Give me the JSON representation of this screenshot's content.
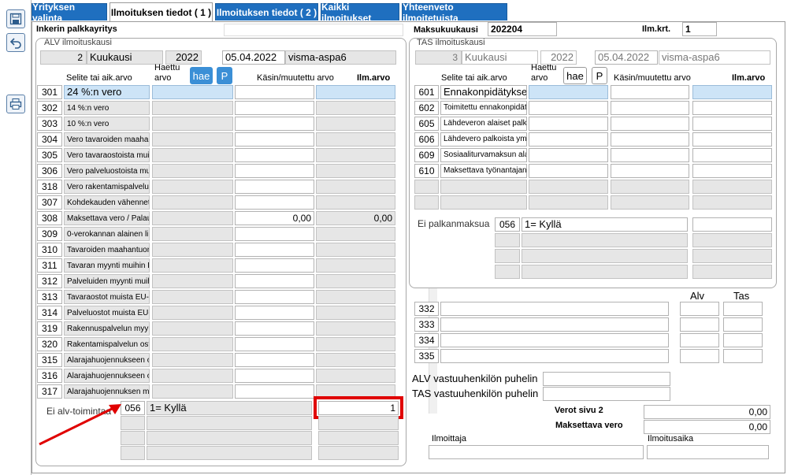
{
  "tabs": [
    {
      "label": "Yrityksen valinta"
    },
    {
      "label": "Ilmoituksen tiedot ( 1 )"
    },
    {
      "label": "Ilmoituksen tiedot ( 2 )"
    },
    {
      "label": "Kaikki ilmoitukset"
    },
    {
      "label": "Yhteenveto ilmoitetuista"
    }
  ],
  "company": "Inkerin palkkayritys",
  "maksukuukausi": {
    "label": "Maksukuukausi",
    "value": "202204"
  },
  "ilmkrt": {
    "label": "Ilm.krt.",
    "value": "1"
  },
  "alv": {
    "legend": "ALV ilmoituskausi",
    "period_num": "2",
    "period_type": "Kuukausi",
    "year": "2022",
    "date": "05.04.2022",
    "system": "visma-aspa6",
    "col_selite": "Selite tai aik.arvo",
    "col_haettu": "Haettu\narvo",
    "hae": "hae",
    "p": "P",
    "col_kasin": "Käsin/muutettu arvo",
    "col_ilm": "Ilm.arvo",
    "rows": [
      {
        "code": "301",
        "desc": "24 %:n vero",
        "kasin": "",
        "ilm": ""
      },
      {
        "code": "302",
        "desc": "14 %:n vero",
        "kasin": "",
        "ilm": ""
      },
      {
        "code": "303",
        "desc": "10 %:n vero",
        "kasin": "",
        "ilm": ""
      },
      {
        "code": "304",
        "desc": "Vero tavaroiden maahan",
        "kasin": "",
        "ilm": ""
      },
      {
        "code": "305",
        "desc": "Vero tavaraostoista muis",
        "kasin": "",
        "ilm": ""
      },
      {
        "code": "306",
        "desc": "Vero palveluostoista mui",
        "kasin": "",
        "ilm": ""
      },
      {
        "code": "318",
        "desc": "Vero rakentamispalvelun",
        "kasin": "",
        "ilm": ""
      },
      {
        "code": "307",
        "desc": "Kohdekauden vähennett",
        "kasin": "",
        "ilm": ""
      },
      {
        "code": "308",
        "desc": "Maksettava vero / Palaut",
        "kasin": "0,00",
        "ilm": "0,00"
      },
      {
        "code": "309",
        "desc": "0-verokannan alainen liik",
        "kasin": "",
        "ilm": ""
      },
      {
        "code": "310",
        "desc": "Tavaroiden maahantuonı",
        "kasin": "",
        "ilm": ""
      },
      {
        "code": "311",
        "desc": "Tavaran myynti muihin E",
        "kasin": "",
        "ilm": ""
      },
      {
        "code": "312",
        "desc": "Palveluiden myynti muih",
        "kasin": "",
        "ilm": ""
      },
      {
        "code": "313",
        "desc": "Tavaraostot muista EU-n",
        "kasin": "",
        "ilm": ""
      },
      {
        "code": "314",
        "desc": "Palveluostot muista EU-r",
        "kasin": "",
        "ilm": ""
      },
      {
        "code": "319",
        "desc": "Rakennuspalvelun myyn",
        "kasin": "",
        "ilm": ""
      },
      {
        "code": "320",
        "desc": "Rakentamispalvelun osto",
        "kasin": "",
        "ilm": ""
      },
      {
        "code": "315",
        "desc": "Alarajahuojennukseen oi",
        "kasin": "",
        "ilm": ""
      },
      {
        "code": "316",
        "desc": "Alarajahuojennukseen oi",
        "kasin": "",
        "ilm": ""
      },
      {
        "code": "317",
        "desc": "Alarajahuojennuksen mä",
        "kasin": "",
        "ilm": ""
      }
    ],
    "ei_alv_label": "Ei alv-toimintaa",
    "ei_alv_code": "056",
    "ei_alv_value": "1= Kyllä",
    "ei_alv_ilm": "1"
  },
  "tas": {
    "legend": "TAS ilmoituskausi",
    "period_num": "3",
    "period_type": "Kuukausi",
    "year": "2022",
    "date": "05.04.2022",
    "system": "visma-aspa6",
    "col_selite": "Selite tai aik.arvo",
    "col_haettu": "Haettu\narvo",
    "hae": "hae",
    "p": "P",
    "col_kasin": "Käsin/muutettu arvo",
    "col_ilm": "Ilm.arvo",
    "rows": [
      {
        "code": "601",
        "desc": "Ennakonpidätykse"
      },
      {
        "code": "602",
        "desc": "Toimitettu ennakonpidät"
      },
      {
        "code": "605",
        "desc": "Lähdeveron alaiset palka"
      },
      {
        "code": "606",
        "desc": "Lähdevero palkoista yms"
      },
      {
        "code": "609",
        "desc": "Sosiaaliturvamaksun alai"
      },
      {
        "code": "610",
        "desc": "Maksettava työnantajan"
      }
    ],
    "ei_palk_label": "Ei palkanmaksua",
    "ei_palk_code": "056",
    "ei_palk_value": "1= Kyllä"
  },
  "extra": {
    "alv_head": "Alv",
    "tas_head": "Tas",
    "codes": [
      "332",
      "333",
      "334",
      "335"
    ]
  },
  "phones": {
    "alv": "ALV vastuuhenkilön puhelin",
    "tas": "TAS vastuuhenkilön puhelin"
  },
  "totals": {
    "verot_label": "Verot sivu 2",
    "verot_value": "0,00",
    "maksettava_label": "Maksettava vero",
    "maksettava_value": "0,00"
  },
  "footer": {
    "ilmoittaja": "Ilmoittaja",
    "ilmoitusaika": "Ilmoitusaika"
  },
  "colors": {
    "tab_blue": "#1f6fbf",
    "highlight_red": "#e00000",
    "row_blue": "#cde4f7",
    "button_blue": "#3b8fd6"
  }
}
